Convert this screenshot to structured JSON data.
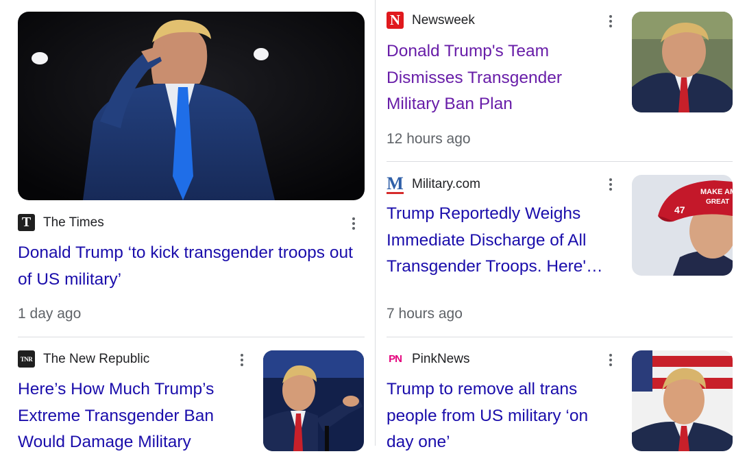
{
  "articles": [
    {
      "source": "The Times",
      "logo_glyph": "T",
      "logo_bg": "#1f1f1f",
      "logo_fg": "#ffffff",
      "title": "Donald Trump ‘to kick transgender troops out of US military’",
      "time": "1 day ago",
      "thumbnail": "trump-saluting-photo"
    },
    {
      "source": "Newsweek",
      "logo_glyph": "N",
      "logo_bg": "#e0191d",
      "logo_fg": "#ffffff",
      "title": "Donald Trump's Team Dismisses Transgender Military Ban Plan",
      "time": "12 hours ago",
      "thumbnail": "trump-portrait-photo"
    },
    {
      "source": "Military.com",
      "logo_glyph": "M",
      "logo_bg": "#ffffff",
      "logo_fg": "#2f5fa8",
      "title": "Trump Reportedly Weighs Immediate Discharge of All Transgender Troops. Here'…",
      "time": "7 hours ago",
      "thumbnail": "trump-red-cap-photo"
    },
    {
      "source": "The New Republic",
      "logo_glyph": "TNR",
      "logo_bg": "#1f1f1f",
      "logo_fg": "#ffffff",
      "title": "Here’s How Much Trump’s Extreme Transgender Ban Would Damage Military",
      "time": "",
      "thumbnail": "trump-speaking-photo"
    },
    {
      "source": "PinkNews",
      "logo_glyph": "PN",
      "logo_bg": "#ffffff",
      "logo_fg": "#e4007c",
      "title": "Trump to remove all trans people from US military ‘on day one’",
      "time": "",
      "thumbnail": "trump-flag-photo"
    }
  ],
  "colors": {
    "link": "#1a0dab",
    "visited_link": "#681da8",
    "meta": "#5f6368",
    "divider": "#dadce0"
  }
}
